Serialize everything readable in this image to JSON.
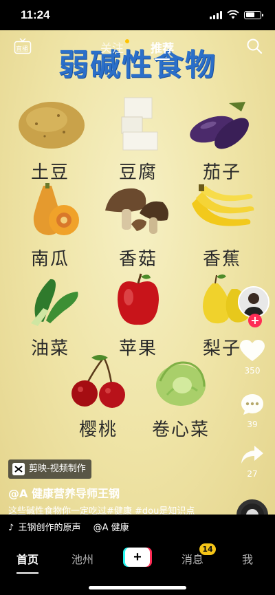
{
  "status_bar": {
    "time": "11:24"
  },
  "top_nav": {
    "live_label": "直播",
    "tabs": [
      {
        "label": "关注"
      },
      {
        "label": "推荐"
      }
    ]
  },
  "video": {
    "headline": "弱碱性食物",
    "foods": [
      {
        "name": "土豆",
        "icon": "potato-icon"
      },
      {
        "name": "豆腐",
        "icon": "tofu-icon"
      },
      {
        "name": "茄子",
        "icon": "eggplant-icon"
      },
      {
        "name": "南瓜",
        "icon": "pumpkin-icon"
      },
      {
        "name": "香菇",
        "icon": "mushroom-icon"
      },
      {
        "name": "香蕉",
        "icon": "banana-icon"
      },
      {
        "name": "油菜",
        "icon": "bok-choy-icon"
      },
      {
        "name": "苹果",
        "icon": "apple-icon"
      },
      {
        "name": "梨子",
        "icon": "pear-icon"
      },
      {
        "name": "樱桃",
        "icon": "cherry-icon"
      },
      {
        "name": "卷心菜",
        "icon": "cabbage-icon"
      }
    ]
  },
  "rail": {
    "follow_symbol": "+",
    "likes": "350",
    "comments": "39",
    "shares": "27"
  },
  "info": {
    "capcut_badge": "剪映-视频制作",
    "author": "@A 健康营养导师王钢",
    "description": "这些碱性食物你一定吃过#健康 #dou是知识点",
    "music_note": "♪",
    "music": "王钢创作的原声",
    "music_author": "@A 健康"
  },
  "tabbar": {
    "home": "首页",
    "local": "池州",
    "create": "+",
    "messages": "消息",
    "messages_badge": "14",
    "me": "我"
  },
  "colors": {
    "headline": "#2b6fc9",
    "accent_red": "#fe2c55",
    "accent_cyan": "#25f4ee",
    "badge_yellow": "#f5c518"
  }
}
